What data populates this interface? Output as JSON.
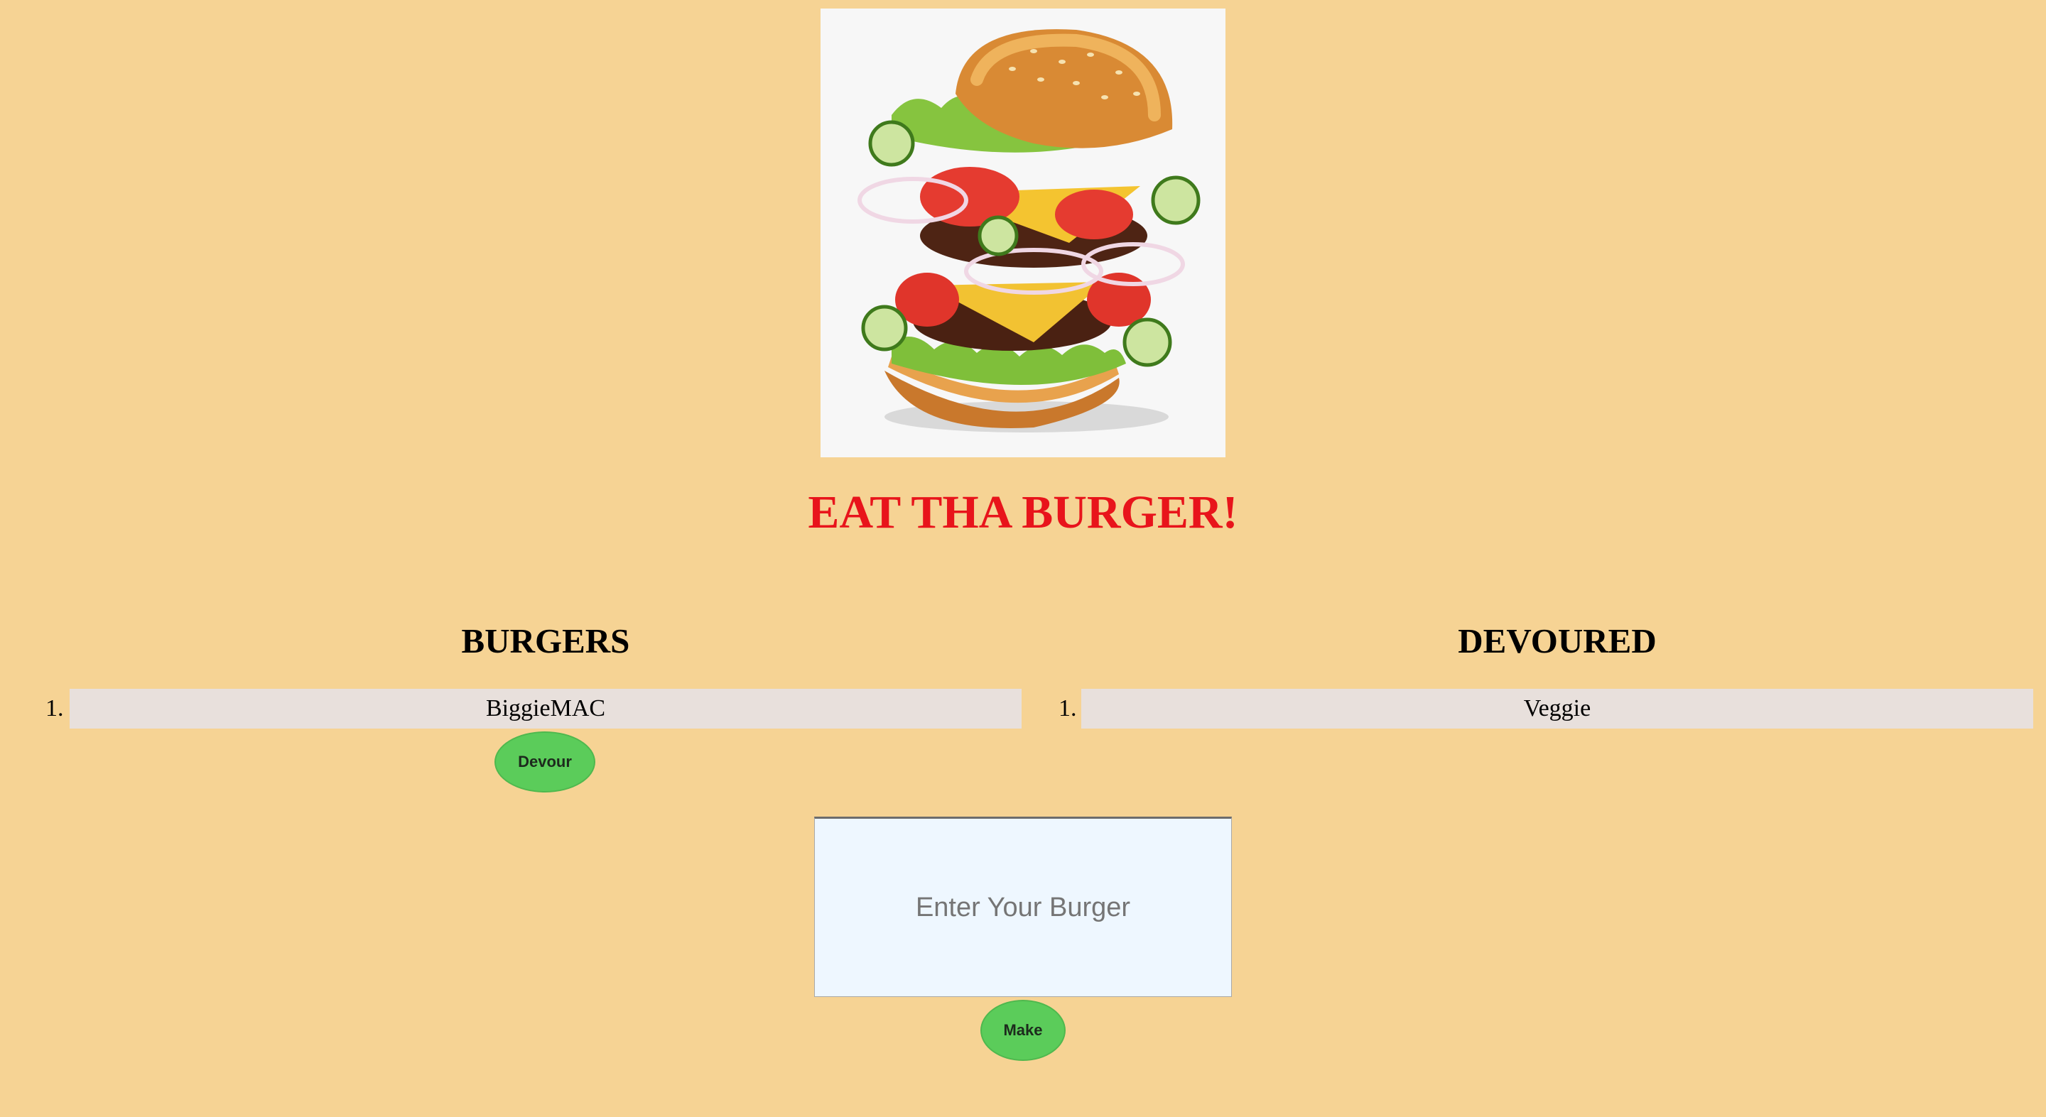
{
  "page": {
    "title": "EAT THA BURGER!"
  },
  "image": {
    "icon": "burger-illustration",
    "alt": "burger"
  },
  "columns": {
    "burgers": {
      "heading": "BURGERS",
      "items": [
        {
          "number": "1.",
          "name": "BiggieMAC"
        }
      ],
      "action_label": "Devour"
    },
    "devoured": {
      "heading": "DEVOURED",
      "items": [
        {
          "number": "1.",
          "name": "Veggie"
        }
      ]
    }
  },
  "form": {
    "placeholder": "Enter Your Burger",
    "value": "",
    "submit_label": "Make"
  },
  "colors": {
    "background": "#f6d394",
    "title": "#e8141b",
    "button": "#5bcc5a",
    "list_item_bg": "#e8e0dc",
    "input_bg": "#eef7ff"
  }
}
